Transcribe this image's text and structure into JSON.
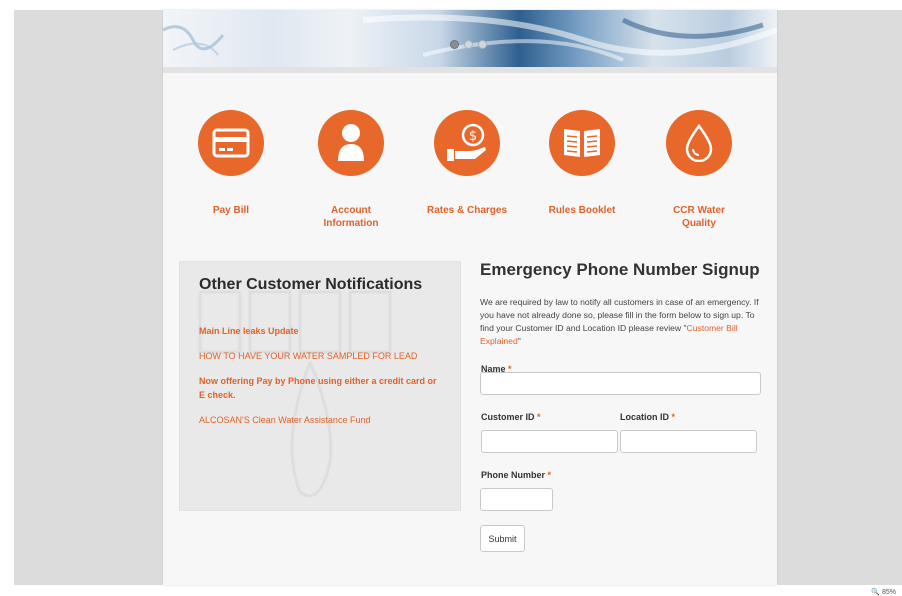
{
  "quicklinks": [
    {
      "label": "Pay Bill",
      "icon": "card-icon"
    },
    {
      "label": "Account Information",
      "icon": "person-icon"
    },
    {
      "label": "Rates & Charges",
      "icon": "coin-hand-icon"
    },
    {
      "label": "Rules Booklet",
      "icon": "booklet-icon"
    },
    {
      "label": "CCR Water Quality",
      "icon": "water-drop-icon"
    }
  ],
  "notifications": {
    "title": "Other Customer Notifications",
    "items": [
      "Main Line leaks Update",
      "HOW TO HAVE YOUR WATER SAMPLED FOR LEAD",
      "Now offering Pay by Phone using either a credit card or E check.",
      "ALCOSAN'S Clean Water Assistance Fund"
    ]
  },
  "signup": {
    "title": "Emergency Phone Number Signup",
    "description": "We are required by law to notify all customers in case of an emergency. If you have not already done so, please fill in the form below to sign up. To find your Customer ID and Location ID please review \"",
    "description_link": "Customer Bill Explained",
    "description_end": "\"",
    "name_label": "Name",
    "customer_id_label": "Customer ID",
    "location_id_label": "Location ID",
    "phone_label": "Phone Number",
    "required_mark": "*",
    "submit_label": "Submit"
  },
  "status": {
    "zoom": "85%"
  },
  "colors": {
    "accent": "#e8682b",
    "link": "#e0622a"
  }
}
